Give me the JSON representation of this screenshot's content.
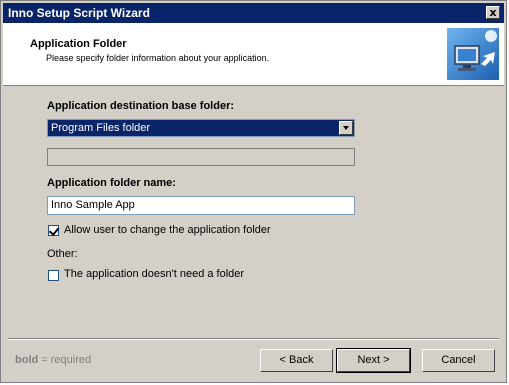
{
  "window": {
    "title": "Inno Setup Script Wizard",
    "close_label": "x"
  },
  "header": {
    "title": "Application Folder",
    "subtitle": "Please specify folder information about your application.",
    "logo_icon": "computer-install-icon"
  },
  "form": {
    "base_folder_label": "Application destination base folder:",
    "base_folder_selected": "Program Files folder",
    "custom_base_folder_value": "",
    "folder_name_label": "Application folder name:",
    "folder_name_value": "Inno Sample App",
    "allow_change_label": "Allow user to change the application folder",
    "allow_change_checked": true,
    "other_label": "Other:",
    "no_folder_label": "The application doesn't need a folder",
    "no_folder_checked": false
  },
  "footer": {
    "legend_bold": "bold",
    "legend_rest": " = required",
    "back_label": "< Back",
    "next_label": "Next >",
    "cancel_label": "Cancel"
  }
}
